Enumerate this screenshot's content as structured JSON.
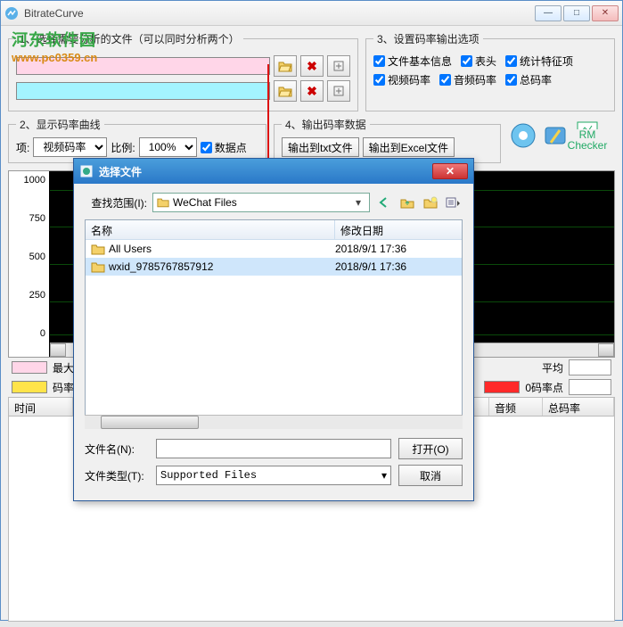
{
  "title": "BitrateCurve",
  "watermark": {
    "line1": "河东软件园",
    "line2": "www.pc0359.cn"
  },
  "group1": {
    "legend": "1、选择需要分析的文件（可以同时分析两个）"
  },
  "group3": {
    "legend": "3、设置码率输出选项",
    "chk": {
      "fileinfo": "文件基本信息",
      "header": "表头",
      "stats": "统计特征项",
      "video": "视频码率",
      "audio": "音频码率",
      "total": "总码率"
    }
  },
  "group2": {
    "legend": "2、显示码率曲线",
    "item_lbl": "项:",
    "item_val": "视频码率",
    "ratio_lbl": "比例:",
    "ratio_val": "100%",
    "datapoint": "数据点"
  },
  "group4": {
    "legend": "4、输出码率数据",
    "btn_txt": "输出到txt文件",
    "btn_xls": "输出到Excel文件"
  },
  "rm_label": "RM\nChecker",
  "yaxis": [
    "1000",
    "750",
    "500",
    "250",
    "0"
  ],
  "legend_rows": {
    "r1a": "最大",
    "r1b": "平均",
    "r2a": "码率",
    "r2b": "0码率点"
  },
  "table": {
    "time": "时间",
    "audio": "音频",
    "total": "总码率"
  },
  "dialog": {
    "title": "选择文件",
    "lookin_lbl": "查找范围(I):",
    "folder": "WeChat Files",
    "col_name": "名称",
    "col_date": "修改日期",
    "rows": [
      {
        "name": "All Users",
        "date": "2018/9/1 17:36"
      },
      {
        "name": "wxid_9785767857912",
        "date": "2018/9/1 17:36"
      }
    ],
    "filename_lbl": "文件名(N):",
    "filename_val": "",
    "filetype_lbl": "文件类型(T):",
    "filetype_val": "Supported Files",
    "open": "打开(O)",
    "cancel": "取消"
  }
}
